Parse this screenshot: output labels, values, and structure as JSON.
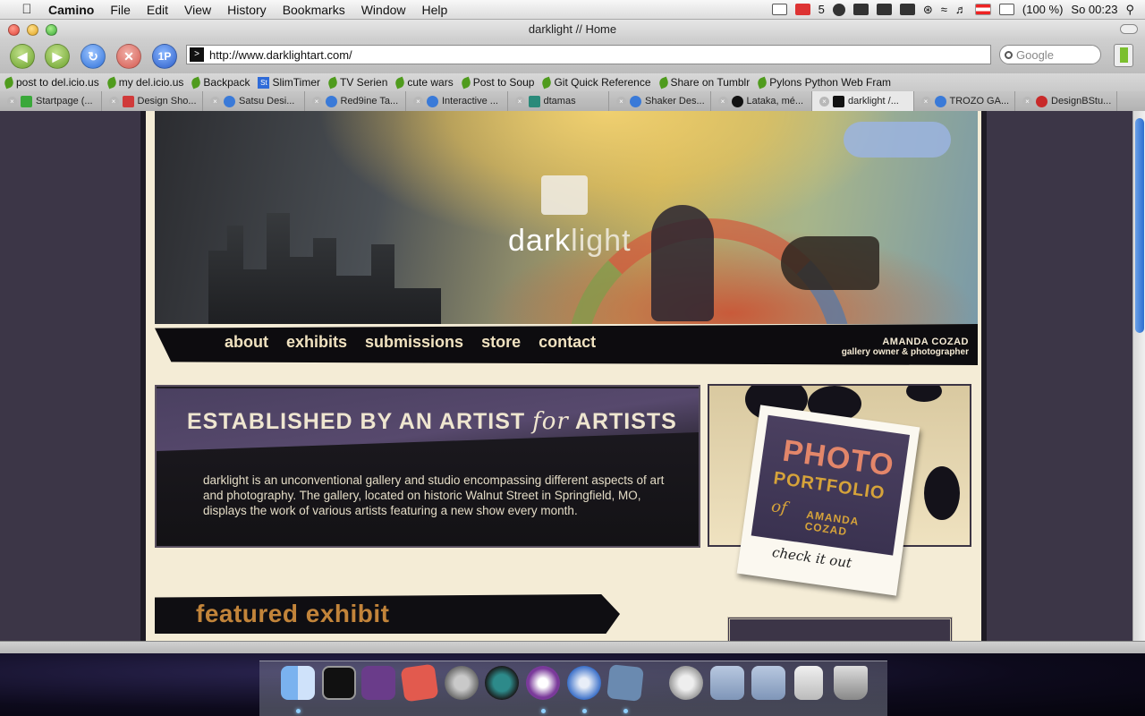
{
  "menubar": {
    "app_name": "Camino",
    "menus": [
      "File",
      "Edit",
      "View",
      "History",
      "Bookmarks",
      "Window",
      "Help"
    ],
    "mail_count": "5",
    "battery": "(100 %)",
    "clock": "So 00:23"
  },
  "window": {
    "title": "darklight // Home"
  },
  "toolbar": {
    "url": "http://www.darklightart.com/",
    "search_placeholder": "Google",
    "one_p_label": "1P"
  },
  "bookmarks": [
    "post to del.icio.us",
    "my del.icio.us",
    "Backpack",
    "SlimTimer",
    "TV Serien",
    "cute wars",
    "Post to Soup",
    "Git Quick Reference",
    "Share on Tumblr",
    "Pylons Python Web Fram"
  ],
  "tabs": [
    {
      "label": "Startpage (...",
      "active": false
    },
    {
      "label": "Design Sho...",
      "active": false
    },
    {
      "label": "Satsu Desi...",
      "active": false
    },
    {
      "label": "Red9ine Ta...",
      "active": false
    },
    {
      "label": "Interactive ...",
      "active": false
    },
    {
      "label": "dtamas",
      "active": false
    },
    {
      "label": "Shaker Des...",
      "active": false
    },
    {
      "label": "Lataka, mé...",
      "active": false
    },
    {
      "label": "darklight /...",
      "active": true
    },
    {
      "label": "TROZO GA...",
      "active": false
    },
    {
      "label": "DesignBStu...",
      "active": false
    }
  ],
  "page": {
    "logo_left": "dark",
    "logo_right": "light",
    "nav": [
      "about",
      "exhibits",
      "submissions",
      "store",
      "contact"
    ],
    "owner_name": "AMANDA COZAD",
    "owner_role": "gallery owner & photographer",
    "intro": {
      "headline_a": "ESTABLISHED BY AN ARTIST",
      "headline_for": "for",
      "headline_b": "ARTISTS",
      "body": "darklight is an unconventional gallery and studio encompassing different aspects of art and photography. The gallery, located on historic Walnut Street in Springfield, MO, displays the work of various artists featuring a new show every month."
    },
    "promo": {
      "line1": "PHOTO",
      "line2": "PORTFOLIO",
      "line3": "of",
      "line4a": "AMANDA",
      "line4b": "COZAD",
      "cta": "check it out"
    },
    "featured": "featured exhibit"
  },
  "colors": {
    "page_bg": "#3c3647",
    "paper": "#f4ecd6",
    "accent_gold": "#c2843a",
    "accent_coral": "#e3866a"
  }
}
